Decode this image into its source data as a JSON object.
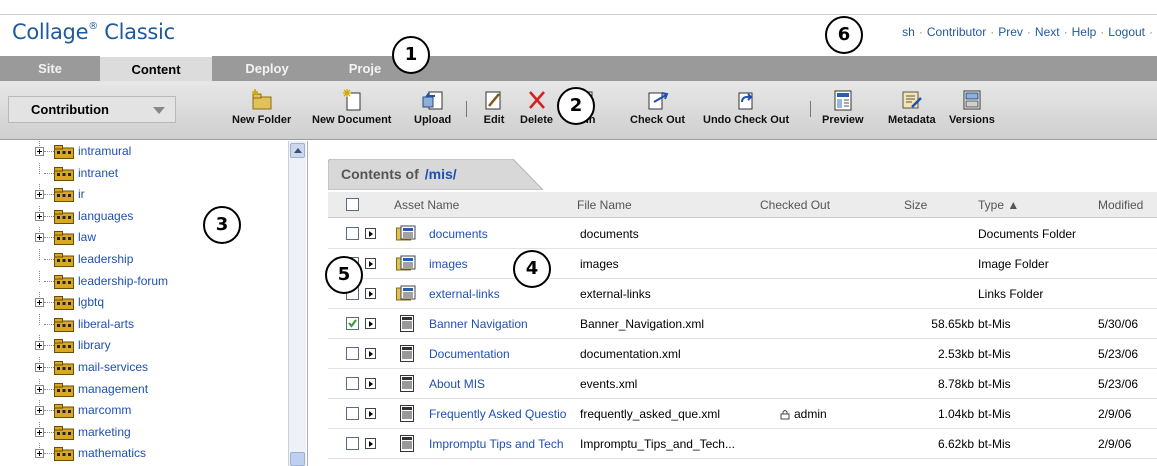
{
  "header": {
    "logo": "Collage",
    "logo_mark": "®",
    "logo_suffix": " Classic",
    "links": [
      "sh",
      "Contributor",
      "Prev",
      "Next",
      "Help",
      "Logout"
    ]
  },
  "tabs": [
    {
      "label": "Site"
    },
    {
      "label": "Content"
    },
    {
      "label": "Deploy"
    },
    {
      "label": "Proje"
    }
  ],
  "toolbar": {
    "mode": "Contribution",
    "buttons": [
      {
        "label": "New Folder",
        "icon": "new-folder-icon"
      },
      {
        "label": "New Document",
        "icon": "new-document-icon"
      },
      {
        "label": "Upload",
        "icon": "upload-icon"
      },
      {
        "label": "Edit",
        "icon": "edit-icon"
      },
      {
        "label": "Delete",
        "icon": "delete-icon"
      },
      {
        "label": "k In",
        "icon": "check-in-icon"
      },
      {
        "label": "Check Out",
        "icon": "check-out-icon"
      },
      {
        "label": "Undo Check Out",
        "icon": "undo-check-out-icon"
      },
      {
        "label": "Preview",
        "icon": "preview-icon"
      },
      {
        "label": "Metadata",
        "icon": "metadata-icon"
      },
      {
        "label": "Versions",
        "icon": "versions-icon"
      }
    ]
  },
  "tree": {
    "items": [
      {
        "label": "intramural",
        "expandable": true
      },
      {
        "label": "intranet",
        "expandable": false
      },
      {
        "label": "ir",
        "expandable": true
      },
      {
        "label": "languages",
        "expandable": true
      },
      {
        "label": "law",
        "expandable": true
      },
      {
        "label": "leadership",
        "expandable": false
      },
      {
        "label": "leadership-forum",
        "expandable": false
      },
      {
        "label": "lgbtq",
        "expandable": true
      },
      {
        "label": "liberal-arts",
        "expandable": false
      },
      {
        "label": "library",
        "expandable": true
      },
      {
        "label": "mail-services",
        "expandable": true
      },
      {
        "label": "management",
        "expandable": true
      },
      {
        "label": "marcomm",
        "expandable": true
      },
      {
        "label": "marketing",
        "expandable": true
      },
      {
        "label": "mathematics",
        "expandable": true
      }
    ]
  },
  "main": {
    "contents_label": "Contents of",
    "path": "/mis/",
    "columns": [
      "Asset Name",
      "File Name",
      "Checked Out",
      "Size",
      "Type ▲",
      "Modified"
    ],
    "rows": [
      {
        "name": "documents",
        "file": "documents",
        "checked_out": "",
        "size": "",
        "type": "Documents Folder",
        "modified": "",
        "kind": "folder",
        "checked": false
      },
      {
        "name": "images",
        "file": "images",
        "checked_out": "",
        "size": "",
        "type": "Image Folder",
        "modified": "",
        "kind": "folder",
        "checked": false
      },
      {
        "name": "external-links",
        "file": "external-links",
        "checked_out": "",
        "size": "",
        "type": "Links Folder",
        "modified": "",
        "kind": "folder",
        "checked": false
      },
      {
        "name": "Banner Navigation",
        "file": "Banner_Navigation.xml",
        "checked_out": "",
        "size": "58.65kb",
        "type": "bt-Mis",
        "modified": "5/30/06",
        "kind": "doc",
        "checked": true
      },
      {
        "name": "Documentation",
        "file": "documentation.xml",
        "checked_out": "",
        "size": "2.53kb",
        "type": "bt-Mis",
        "modified": "5/23/06",
        "kind": "doc",
        "checked": false
      },
      {
        "name": "About MIS",
        "file": "events.xml",
        "checked_out": "",
        "size": "8.78kb",
        "type": "bt-Mis",
        "modified": "5/23/06",
        "kind": "doc",
        "checked": false
      },
      {
        "name": "Frequently Asked Questio",
        "file": "frequently_asked_que.xml",
        "checked_out": "admin",
        "size": "1.04kb",
        "type": "bt-Mis",
        "modified": "2/9/06",
        "kind": "doc",
        "checked": false
      },
      {
        "name": "Impromptu Tips and Tech",
        "file": "Impromptu_Tips_and_Tech...",
        "checked_out": "",
        "size": "6.62kb",
        "type": "bt-Mis",
        "modified": "2/9/06",
        "kind": "doc",
        "checked": false
      }
    ]
  },
  "callouts": [
    "1",
    "2",
    "3",
    "4",
    "5",
    "6"
  ],
  "colors": {
    "brand": "#1f5a9c",
    "link": "#1f4fb5",
    "tabbar": "#9a9a9a",
    "check": "#2e9a2e"
  }
}
